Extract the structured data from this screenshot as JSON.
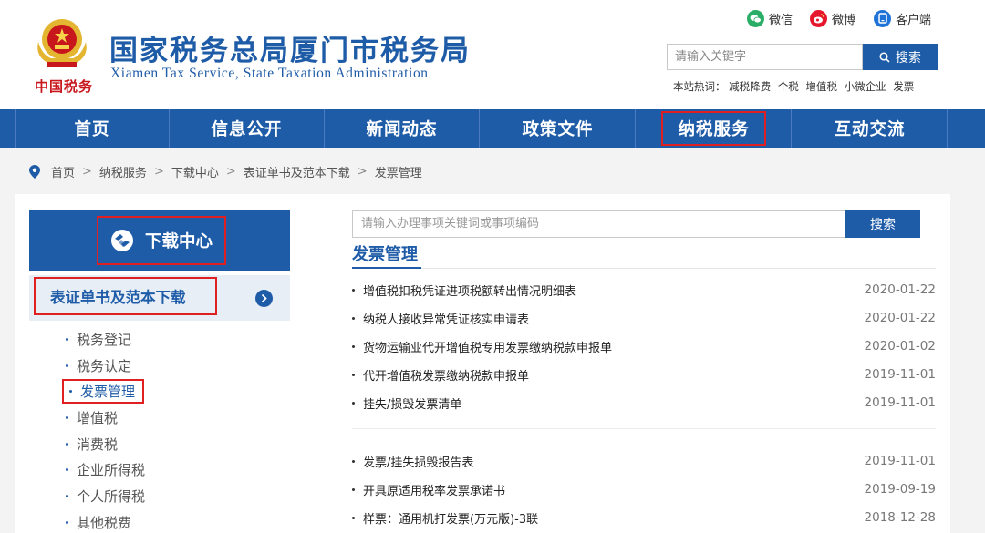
{
  "header": {
    "title": "国家税务总局厦门市税务局",
    "subtitle": "Xiamen Tax Service, State Taxation Administration",
    "brand_script": "中国税务",
    "social": [
      {
        "label": "微信",
        "icon": "wechat-icon",
        "color": "#2aae67"
      },
      {
        "label": "微博",
        "icon": "weibo-icon",
        "color": "#e6162d"
      },
      {
        "label": "客户端",
        "icon": "client-icon",
        "color": "#1f73d8"
      }
    ],
    "search": {
      "placeholder": "请输入关键字",
      "button": "搜索"
    },
    "hotwords": {
      "label": "本站热词：",
      "items": [
        "减税降费",
        "个税",
        "增值税",
        "小微企业",
        "发票"
      ]
    }
  },
  "nav": {
    "items": [
      {
        "label": "首页"
      },
      {
        "label": "信息公开"
      },
      {
        "label": "新闻动态"
      },
      {
        "label": "政策文件"
      },
      {
        "label": "纳税服务"
      },
      {
        "label": "互动交流"
      }
    ],
    "active_index": 4
  },
  "breadcrumb": [
    "首页",
    "纳税服务",
    "下载中心",
    "表证单书及范本下载",
    "发票管理"
  ],
  "sidebar": {
    "heading": "下载中心",
    "category": "表证单书及范本下载",
    "links": [
      "税务登记",
      "税务认定",
      "发票管理",
      "增值税",
      "消费税",
      "企业所得税",
      "个人所得税",
      "其他税费"
    ],
    "active_index": 2
  },
  "main": {
    "search": {
      "placeholder": "请输入办理事项关键词或事项编码",
      "button": "搜索"
    },
    "section_title": "发票管理",
    "documents": [
      {
        "title": "增值税扣税凭证进项税额转出情况明细表",
        "date": "2020-01-22"
      },
      {
        "title": "纳税人接收异常凭证核实申请表",
        "date": "2020-01-22"
      },
      {
        "title": "货物运输业代开增值税专用发票缴纳税款申报单",
        "date": "2020-01-02"
      },
      {
        "title": "代开增值税发票缴纳税款申报单",
        "date": "2019-11-01"
      },
      {
        "title": "挂失/损毁发票清单",
        "date": "2019-11-01"
      },
      {
        "title": "发票/挂失损毁报告表",
        "date": "2019-11-01"
      },
      {
        "title": "开具原适用税率发票承诺书",
        "date": "2019-09-19"
      },
      {
        "title": "样票：通用机打发票(万元版)-3联",
        "date": "2018-12-28"
      }
    ]
  },
  "colors": {
    "brand_blue": "#1f5ca8",
    "highlight_red": "#e02020",
    "emblem_red": "#c8161d",
    "emblem_gold": "#e4b531"
  }
}
